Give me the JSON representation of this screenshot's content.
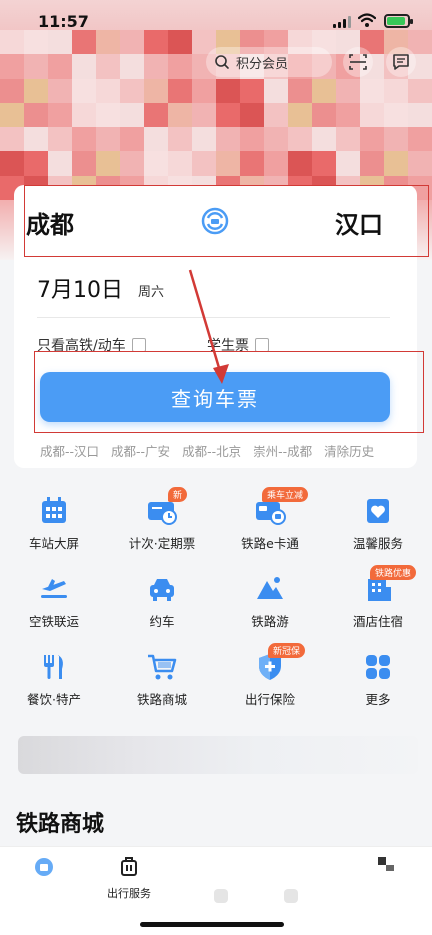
{
  "status_bar": {
    "time": "11:57"
  },
  "header": {
    "search_placeholder": "积分会员"
  },
  "booking": {
    "from": "成都",
    "to": "汉口",
    "date": "7月10日",
    "weekday": "周六",
    "only_high_speed": "只看高铁/动车",
    "student_ticket": "学生票",
    "search_button": "查询车票",
    "history": [
      "成都--汉口",
      "成都--广安",
      "成都--北京",
      "崇州--成都"
    ],
    "clear_history": "清除历史"
  },
  "menu": {
    "items": [
      {
        "label": "车站大屏",
        "icon": "station-screen-icon"
      },
      {
        "label": "计次·定期票",
        "icon": "ticket-card-icon",
        "badge": "新"
      },
      {
        "label": "铁路e卡通",
        "icon": "e-card-icon",
        "badge": "乘车立减"
      },
      {
        "label": "温馨服务",
        "icon": "heart-service-icon"
      },
      {
        "label": "空铁联运",
        "icon": "plane-train-icon"
      },
      {
        "label": "约车",
        "icon": "car-icon"
      },
      {
        "label": "铁路游",
        "icon": "mountain-travel-icon"
      },
      {
        "label": "酒店住宿",
        "icon": "hotel-icon",
        "badge": "铁路优惠"
      },
      {
        "label": "餐饮·特产",
        "icon": "food-icon"
      },
      {
        "label": "铁路商城",
        "icon": "shopping-cart-icon"
      },
      {
        "label": "出行保险",
        "icon": "shield-icon",
        "badge": "新冠保"
      },
      {
        "label": "更多",
        "icon": "more-grid-icon"
      }
    ]
  },
  "section_title": "铁路商城",
  "tabbar": {
    "items": [
      {
        "label": ""
      },
      {
        "label": "出行服务"
      },
      {
        "label": ""
      },
      {
        "label": ""
      },
      {
        "label": ""
      }
    ]
  },
  "colors": {
    "accent": "#4b9cf5",
    "highlight_box": "#d23a36",
    "badge": "#f26a3b"
  }
}
